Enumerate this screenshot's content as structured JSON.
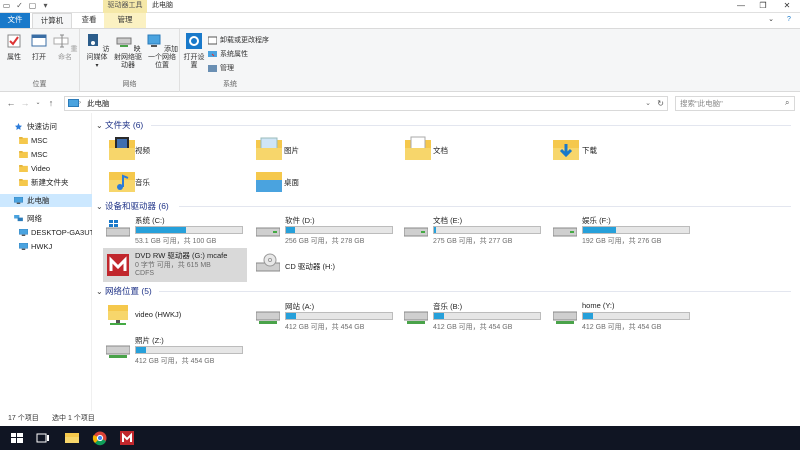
{
  "window": {
    "title": "此电脑",
    "context_tab_group": "驱动器工具"
  },
  "tabs": [
    {
      "label": "文件"
    },
    {
      "label": "计算机"
    },
    {
      "label": "查看"
    },
    {
      "label": "管理"
    }
  ],
  "ribbon": {
    "location_group": {
      "label": "位置",
      "buttons": [
        {
          "label": "属性"
        },
        {
          "label": "打开"
        },
        {
          "label": "重命名"
        }
      ]
    },
    "network_group": {
      "label": "网络",
      "buttons": [
        {
          "label": "访问媒体"
        },
        {
          "label": "映射网络驱动器"
        },
        {
          "label": "添加一个网络位置"
        }
      ]
    },
    "system_group": {
      "label": "系统",
      "open_settings": "打开设置",
      "items": [
        {
          "label": "卸载或更改程序"
        },
        {
          "label": "系统属性"
        },
        {
          "label": "管理"
        }
      ]
    }
  },
  "address": {
    "path": "此电脑",
    "search_placeholder": "搜索\"此电脑\""
  },
  "nav": {
    "quick_access": "快速访问",
    "items": [
      {
        "label": "MSC"
      },
      {
        "label": "MSC"
      },
      {
        "label": "Video"
      },
      {
        "label": "新建文件夹"
      }
    ],
    "this_pc": "此电脑",
    "network": "网络",
    "network_items": [
      {
        "label": "DESKTOP-GA3UT"
      },
      {
        "label": "HWKJ"
      }
    ]
  },
  "sections": {
    "folders_title": "文件夹 (6)",
    "drives_title": "设备和驱动器 (6)",
    "network_title": "网络位置 (5)"
  },
  "folders": [
    {
      "name": "视频",
      "icon": "video-folder-icon"
    },
    {
      "name": "图片",
      "icon": "pictures-folder-icon"
    },
    {
      "name": "文档",
      "icon": "documents-folder-icon"
    },
    {
      "name": "下载",
      "icon": "downloads-folder-icon"
    },
    {
      "name": "音乐",
      "icon": "music-folder-icon"
    },
    {
      "name": "桌面",
      "icon": "desktop-folder-icon"
    }
  ],
  "drives": [
    {
      "name": "系统 (C:)",
      "free": "53.1 GB 可用，共 100 GB",
      "used": 0.47
    },
    {
      "name": "软件 (D:)",
      "free": "256 GB 可用，共 278 GB",
      "used": 0.08
    },
    {
      "name": "文档 (E:)",
      "free": "275 GB 可用，共 277 GB",
      "used": 0.01
    },
    {
      "name": "娱乐 (F:)",
      "free": "192 GB 可用，共 276 GB",
      "used": 0.3
    }
  ],
  "dvd": {
    "name": "DVD RW 驱动器 (G:) mcafe",
    "free": "0 字节 可用，共 615 MB",
    "fs": "CDFS"
  },
  "cd": {
    "name": "CD 驱动器 (H:)"
  },
  "network_locations": [
    {
      "name": "video (HWKJ)"
    },
    {
      "name": "网站 (A:)",
      "free": "412 GB 可用，共 454 GB",
      "used": 0.09
    },
    {
      "name": "音乐 (B:)",
      "free": "412 GB 可用，共 454 GB",
      "used": 0.09
    },
    {
      "name": "home (Y:)",
      "free": "412 GB 可用，共 454 GB",
      "used": 0.09
    },
    {
      "name": "照片 (Z:)",
      "free": "412 GB 可用，共 454 GB",
      "used": 0.09
    }
  ],
  "status": {
    "count": "17 个项目",
    "selected": "选中 1 个项目"
  },
  "colors": {
    "accent": "#1979ca",
    "bar_fill": "#26a0da",
    "taskbar": "#101523",
    "section_title": "#1e3287"
  }
}
